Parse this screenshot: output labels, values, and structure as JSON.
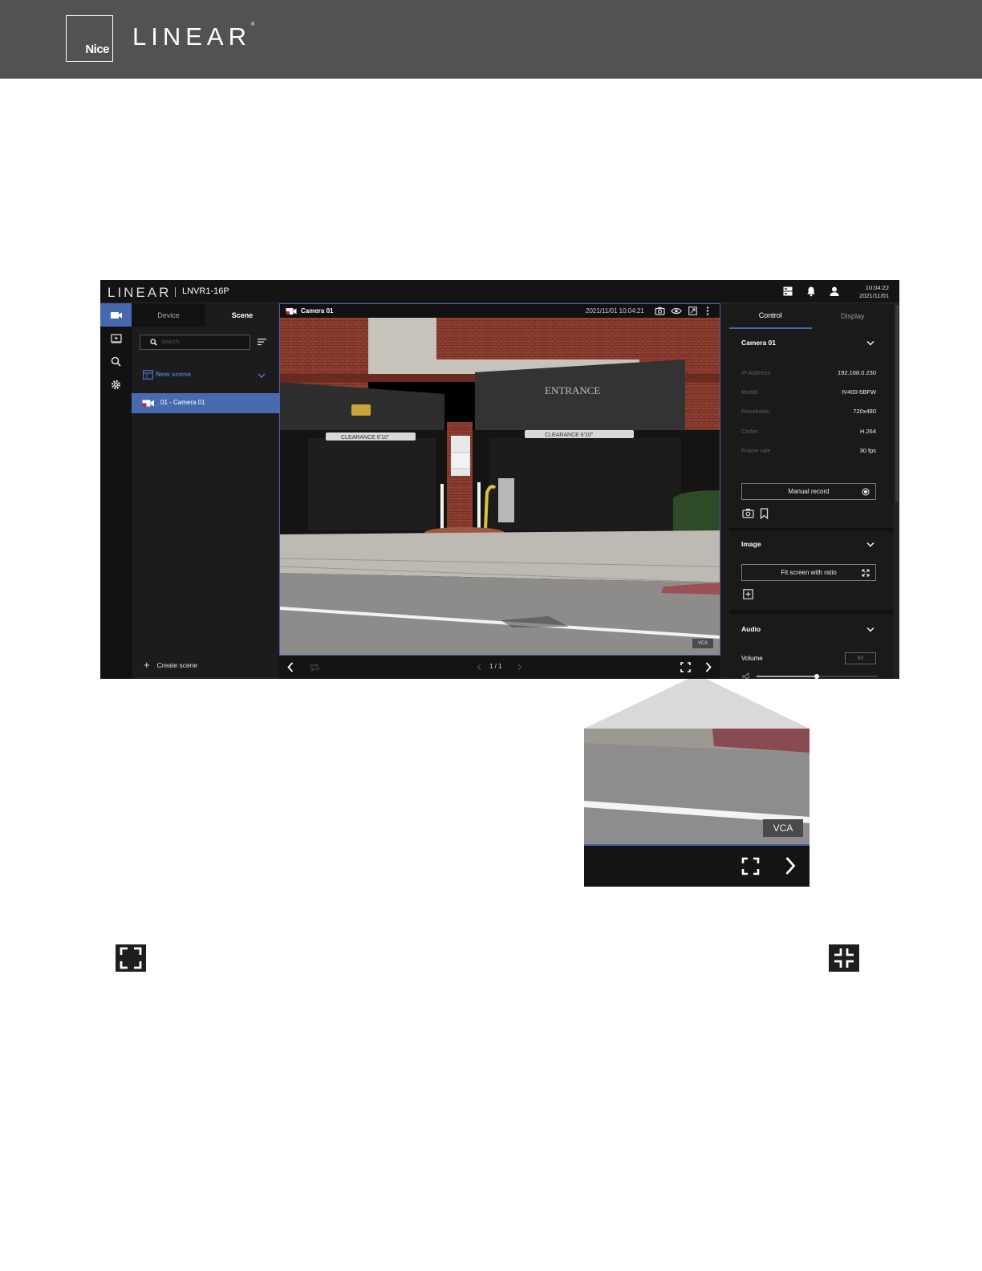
{
  "header": {
    "nice_logo_text": "Nice",
    "linear_logo_text": "LINEAR",
    "trademark": "®"
  },
  "app": {
    "brand": "LINEAR",
    "model": "LNVR1-16P",
    "clock": {
      "time": "10:04:22",
      "date": "2021/11/01"
    },
    "nav_rail": [
      "camera-icon",
      "playback-icon",
      "search-icon",
      "settings-icon"
    ],
    "left_panel": {
      "tabs": {
        "device": "Device",
        "scene": "Scene"
      },
      "search_placeholder": "Search",
      "scene_group": "New scene",
      "scene_camera": "01 - Camera 01",
      "create_scene": "Create scene"
    },
    "viewer": {
      "camera_name": "Camera 01",
      "timestamp": "2021/11/01 10:04:21",
      "vca_badge": "VCA",
      "pager": "1 / 1",
      "scene_sign": "ENTRANCE",
      "clearance_left": "CLEARANCE 6'10\"",
      "clearance_right": "CLEARANCE 6'10\""
    },
    "right_panel": {
      "tabs": {
        "control": "Control",
        "display": "Display"
      },
      "camera_section": "Camera 01",
      "properties": [
        {
          "key": "IP Address",
          "value": "192.168.0.230"
        },
        {
          "key": "Model",
          "value": "IV400-5BFW"
        },
        {
          "key": "Resolution",
          "value": "720x480"
        },
        {
          "key": "Codec",
          "value": "H.264"
        },
        {
          "key": "Frame rate",
          "value": "30 fps"
        }
      ],
      "manual_record": "Manual record",
      "image_section": "Image",
      "fit_screen": "Fit screen with ratio",
      "audio_section": "Audio",
      "volume_label": "Volume",
      "volume_value": "50"
    }
  },
  "zoom": {
    "vca_badge": "VCA"
  },
  "colors": {
    "accent": "#4868ad",
    "header_bg": "#525252",
    "app_bg": "#1b1b1b"
  }
}
